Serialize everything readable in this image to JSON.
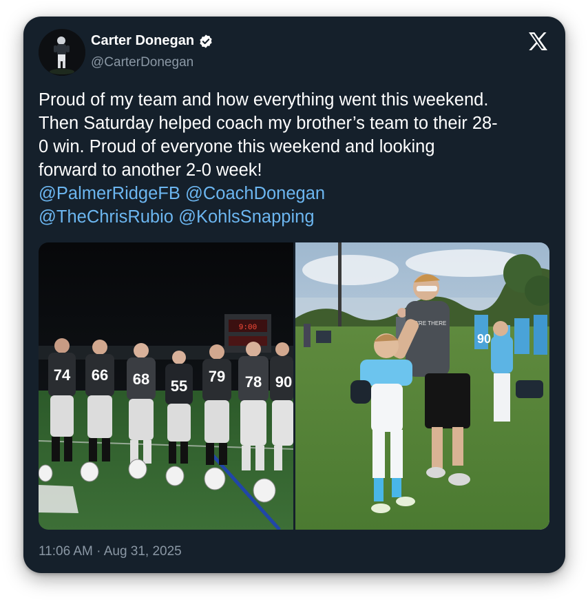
{
  "post": {
    "author_name": "Carter Donegan",
    "author_handle": "@CarterDonegan",
    "text_line1": "Proud of my team and how everything went this weekend.",
    "text_line2": "Then Saturday helped coach my brother’s team to their 28-",
    "text_line3": "0 win. Proud of everyone this weekend and looking",
    "text_line4": "forward to another 2-0 week!",
    "mentions_line1": [
      "@PalmerRidgeFB",
      "@CoachDonegan"
    ],
    "mentions_line2": [
      "@TheChrisRubio",
      "@KohlsSnapping"
    ],
    "timestamp": "11:06 AM · Aug 31, 2025"
  },
  "icons": {
    "verified": "verified-badge-icon",
    "platform": "x-logo-icon"
  },
  "photo_left": {
    "jersey_numbers": [
      "74",
      "66",
      "68",
      "55",
      "79",
      "78",
      "90"
    ],
    "scoreboard": "9:00"
  },
  "photo_right": {
    "jersey_numbers": [
      "90"
    ],
    "shirt_text": "WE'RE THERE"
  },
  "colors": {
    "card_bg": "#15202b",
    "text": "#ffffff",
    "muted": "#8b98a5",
    "mention": "#6cb6f0"
  }
}
